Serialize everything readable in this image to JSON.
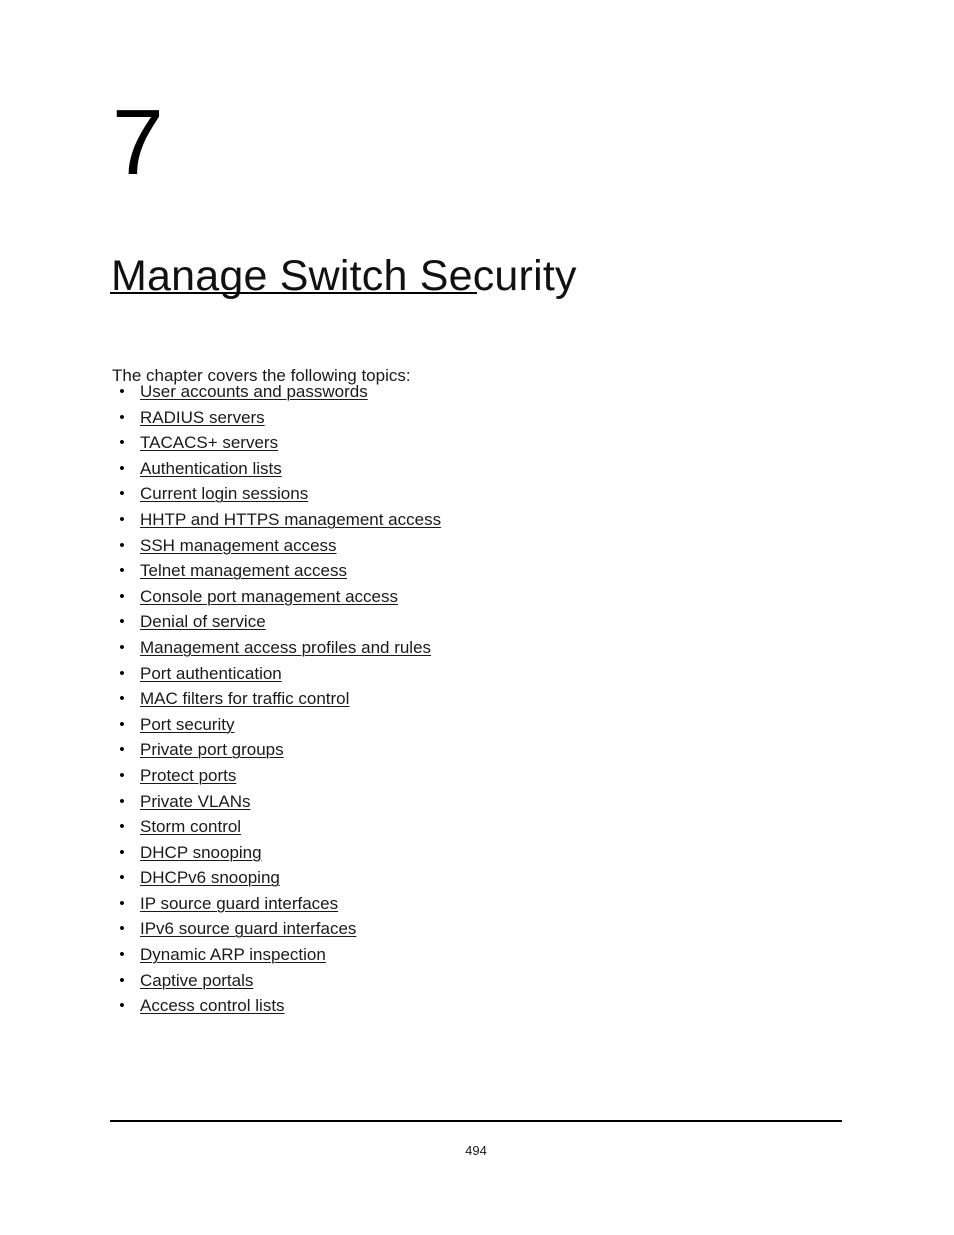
{
  "page": {
    "chapter_number": "7",
    "chapter_title": "Manage Switch Security",
    "intro": "The chapter covers the following topics:",
    "page_number": "494",
    "bullet_glyph": "•",
    "text_color": "#1a1a1a",
    "rule_color": "#000000"
  },
  "topics": [
    {
      "label": "User accounts and passwords"
    },
    {
      "label": "RADIUS servers"
    },
    {
      "label": "TACACS+ servers"
    },
    {
      "label": "Authentication lists"
    },
    {
      "label": "Current login sessions"
    },
    {
      "label": "HHTP and HTTPS management access"
    },
    {
      "label": "SSH management access"
    },
    {
      "label": "Telnet management access"
    },
    {
      "label": "Console port management access"
    },
    {
      "label": "Denial of service"
    },
    {
      "label": "Management access profiles and rules"
    },
    {
      "label": "Port authentication"
    },
    {
      "label": "MAC filters for traffic control"
    },
    {
      "label": "Port security"
    },
    {
      "label": "Private port groups"
    },
    {
      "label": "Protect ports"
    },
    {
      "label": "Private VLANs"
    },
    {
      "label": "Storm control"
    },
    {
      "label": "DHCP snooping"
    },
    {
      "label": "DHCPv6 snooping"
    },
    {
      "label": "IP source guard interfaces"
    },
    {
      "label": "IPv6 source guard interfaces"
    },
    {
      "label": "Dynamic ARP inspection"
    },
    {
      "label": "Captive portals"
    },
    {
      "label": "Access control lists"
    }
  ]
}
